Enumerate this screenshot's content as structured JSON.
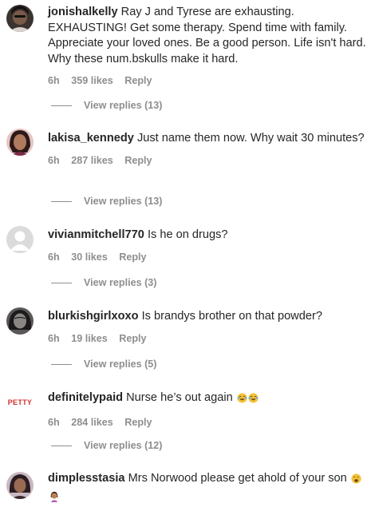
{
  "comments": [
    {
      "username": "jonishalkelly",
      "text": "Ray J and Tyrese are exhausting. EXHAUSTING! Get some therapy. Spend time with family. Appreciate your loved ones. Be a good person. Life isn't hard. Why these num.bskulls make it hard.",
      "time": "6h",
      "likes": "359 likes",
      "reply": "Reply",
      "view_replies": "View replies (13)"
    },
    {
      "username": "lakisa_kennedy",
      "text": "Just name them now. Why wait 30 minutes?",
      "time": "6h",
      "likes": "287 likes",
      "reply": "Reply",
      "view_replies": "View replies (13)"
    },
    {
      "username": "vivianmitchell770",
      "text": "Is he on drugs?",
      "time": "6h",
      "likes": "30 likes",
      "reply": "Reply",
      "view_replies": "View replies (3)"
    },
    {
      "username": "blurkishgirlxoxo",
      "text": "Is brandys brother on that powder?",
      "time": "6h",
      "likes": "19 likes",
      "reply": "Reply",
      "view_replies": "View replies (5)"
    },
    {
      "username": "definitelypaid",
      "text": "Nurse he’s out again",
      "time": "6h",
      "likes": "284 likes",
      "reply": "Reply",
      "view_replies": "View replies (12)",
      "avatar_text": "PETTY"
    },
    {
      "username": "dimplesstasia",
      "text": "Mrs Norwood please get ahold of your son"
    }
  ],
  "icons": {
    "laughing": "face-with-tears-of-joy-icon",
    "weary": "weary-face-icon",
    "facepalm": "person-facepalming-icon"
  },
  "colors": {
    "text": "#262626",
    "secondary": "#8e8e8e",
    "petty_red": "#d0312d"
  }
}
